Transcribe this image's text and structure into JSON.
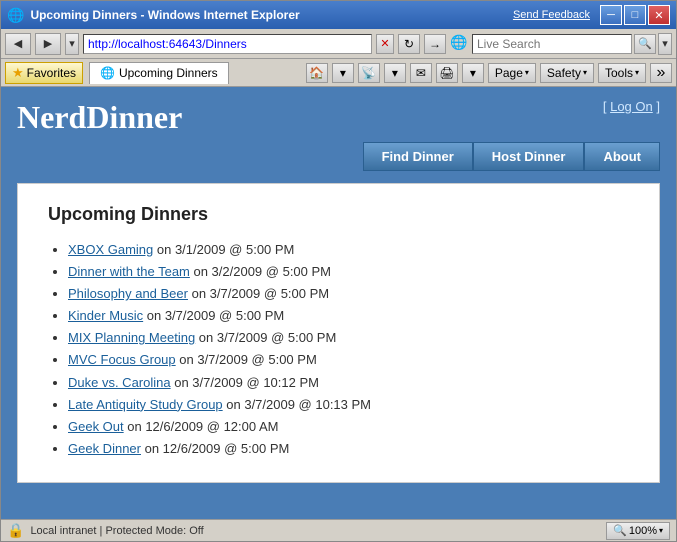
{
  "window": {
    "title": "Upcoming Dinners - Windows Internet Explorer",
    "send_feedback": "Send Feedback"
  },
  "address_bar": {
    "url": "http://localhost:64643/Dinners",
    "search_placeholder": "Live Search"
  },
  "toolbar": {
    "favorites_label": "Favorites",
    "tab_label": "Upcoming Dinners"
  },
  "toolbar_buttons": {
    "page_label": "Page",
    "safety_label": "Safety",
    "tools_label": "Tools"
  },
  "header": {
    "title": "NerdDinner",
    "login_prefix": "[",
    "login_link": "Log On",
    "login_suffix": "]"
  },
  "nav": {
    "find_dinner": "Find Dinner",
    "host_dinner": "Host Dinner",
    "about": "About"
  },
  "main": {
    "heading": "Upcoming Dinners",
    "dinners": [
      {
        "name": "XBOX Gaming",
        "detail": " on 3/1/2009 @ 5:00 PM"
      },
      {
        "name": "Dinner with the Team",
        "detail": " on 3/2/2009 @ 5:00 PM"
      },
      {
        "name": "Philosophy and Beer",
        "detail": " on 3/7/2009 @ 5:00 PM"
      },
      {
        "name": "Kinder Music",
        "detail": " on 3/7/2009 @ 5:00 PM"
      },
      {
        "name": "MIX Planning Meeting",
        "detail": " on 3/7/2009 @ 5:00 PM"
      },
      {
        "name": "MVC Focus Group",
        "detail": " on 3/7/2009 @ 5:00 PM"
      },
      {
        "name": "Duke vs. Carolina",
        "detail": " on 3/7/2009 @ 10:12 PM"
      },
      {
        "name": "Late Antiquity Study Group",
        "detail": " on 3/7/2009 @ 10:13 PM"
      },
      {
        "name": "Geek Out",
        "detail": " on 12/6/2009 @ 12:00 AM"
      },
      {
        "name": "Geek Dinner",
        "detail": " on 12/6/2009 @ 5:00 PM"
      }
    ]
  },
  "status_bar": {
    "icon": "🔒",
    "text": "Local intranet | Protected Mode: Off",
    "zoom_label": "100%"
  }
}
